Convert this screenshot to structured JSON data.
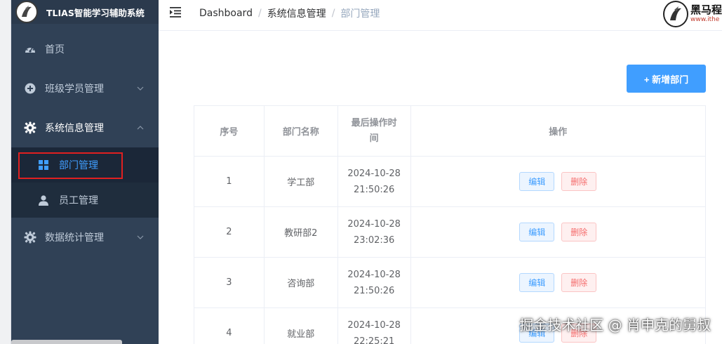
{
  "app": {
    "title": "TLIAS智能学习辅助系统"
  },
  "sidebar": {
    "items": [
      {
        "label": "首页",
        "icon": "dashboard-icon"
      },
      {
        "label": "班级学员管理",
        "icon": "plus-circle-icon"
      },
      {
        "label": "系统信息管理",
        "icon": "gear-icon"
      },
      {
        "label": "数据统计管理",
        "icon": "gear-icon"
      }
    ],
    "sub_items": [
      {
        "label": "部门管理",
        "icon": "grid-icon",
        "active": true
      },
      {
        "label": "员工管理",
        "icon": "user-icon",
        "active": false
      }
    ]
  },
  "header": {
    "breadcrumb": [
      "Dashboard",
      "系统信息管理",
      "部门管理"
    ],
    "brand_name": "黑马程",
    "brand_url": "www.ithe"
  },
  "toolbar": {
    "add_label": "+ 新增部门"
  },
  "table": {
    "headers": [
      "序号",
      "部门名称",
      "最后操作时间",
      "操作"
    ],
    "rows": [
      {
        "id": "1",
        "name": "学工部",
        "date": "2024-10-28",
        "time": "21:50:26"
      },
      {
        "id": "2",
        "name": "教研部2",
        "date": "2024-10-28",
        "time": "23:02:36"
      },
      {
        "id": "3",
        "name": "咨询部",
        "date": "2024-10-28",
        "time": "21:50:26"
      },
      {
        "id": "4",
        "name": "就业部",
        "date": "2024-10-28",
        "time": "22:25:21"
      }
    ],
    "edit_label": "编辑",
    "delete_label": "删除"
  },
  "watermark": "掘金技术社区 @ 肖申克的舅叔",
  "colors": {
    "sidebar_bg": "#304156",
    "primary": "#409eff",
    "danger": "#f56c6c",
    "highlight": "#e02020"
  }
}
